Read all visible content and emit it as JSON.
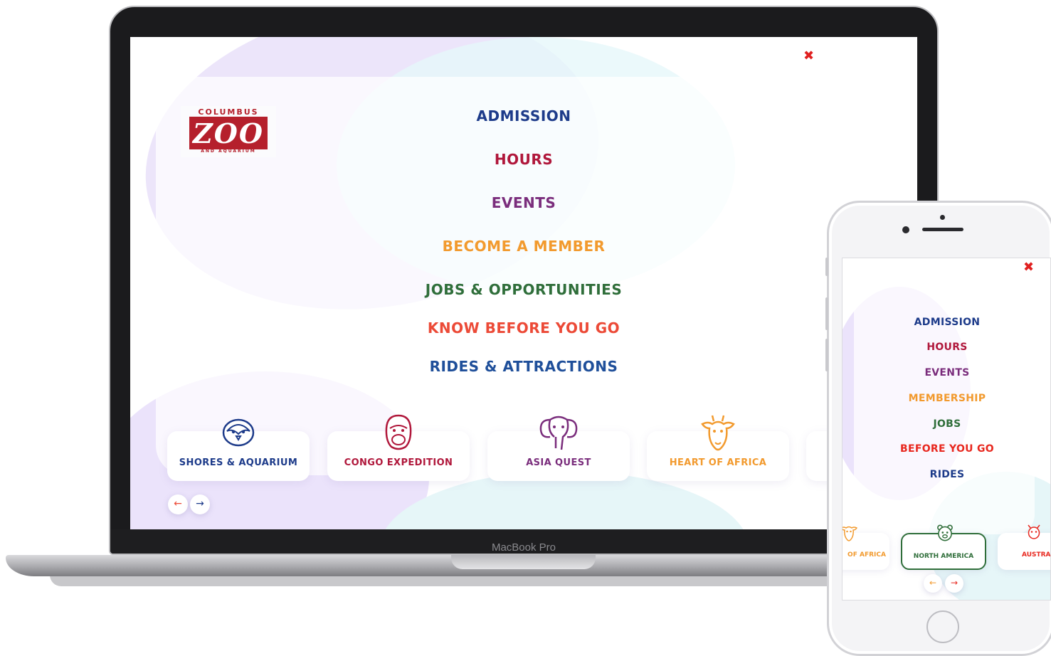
{
  "device_label": "MacBook Pro",
  "brand": {
    "top": "COLUMBUS",
    "word": "ZOO",
    "bottom": "AND AQUARIUM",
    "color": "#b5202c"
  },
  "close_symbol": "✖",
  "desktop_menu": [
    {
      "label": "ADMISSION",
      "color": "#1d3b8a"
    },
    {
      "label": "HOURS",
      "color": "#b0173b"
    },
    {
      "label": "EVENTS",
      "color": "#7a2d7c"
    },
    {
      "label": "BECOME A MEMBER",
      "color": "#f29a2e"
    },
    {
      "label": "JOBS & OPPORTUNITIES",
      "color": "#2f6e3a"
    },
    {
      "label": "KNOW BEFORE YOU GO",
      "color": "#ec4a37"
    },
    {
      "label": "RIDES & ATTRACTIONS",
      "color": "#1f4f9a"
    }
  ],
  "regions": [
    {
      "label": "SHORES & AQUARIUM",
      "icon": "penguin-icon",
      "color": "#1d3b8a"
    },
    {
      "label": "CONGO EXPEDITION",
      "icon": "gorilla-icon",
      "color": "#b0173b"
    },
    {
      "label": "ASIA QUEST",
      "icon": "elephant-icon",
      "color": "#7a2d7c"
    },
    {
      "label": "HEART OF AFRICA",
      "icon": "giraffe-icon",
      "color": "#f29a2e"
    }
  ],
  "carousel": {
    "prev": "←",
    "next": "→",
    "prev_color": "#ec4a37",
    "next_color": "#1d3b8a"
  },
  "mobile_menu": [
    {
      "label": "ADMISSION",
      "color": "#1d3b8a"
    },
    {
      "label": "HOURS",
      "color": "#b0173b"
    },
    {
      "label": "EVENTS",
      "color": "#7a2d7c"
    },
    {
      "label": "MEMBERSHIP",
      "color": "#f29a2e"
    },
    {
      "label": "JOBS",
      "color": "#2f6e3a"
    },
    {
      "label": "BEFORE YOU GO",
      "color": "#e8281f"
    },
    {
      "label": "RIDES",
      "color": "#1d3b8a"
    }
  ],
  "mobile_regions": [
    {
      "label": "OF AFRICA",
      "icon": "giraffe-icon",
      "color": "#f29a2e"
    },
    {
      "label": "NORTH AMERICA",
      "icon": "bear-icon",
      "color": "#2f6e3a"
    },
    {
      "label": "AUSTRA",
      "icon": "kangaroo-icon",
      "color": "#e8281f"
    }
  ]
}
